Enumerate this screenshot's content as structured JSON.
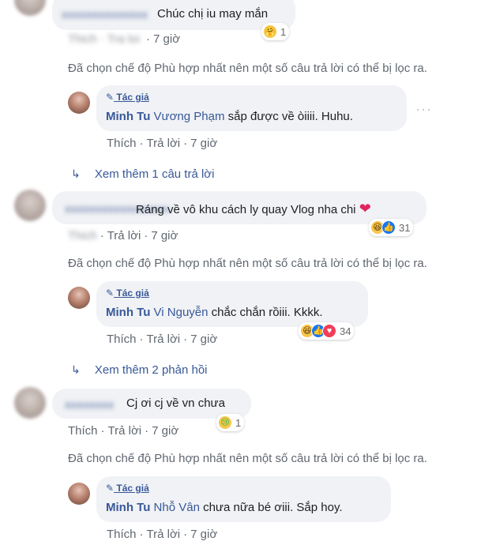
{
  "thread1": {
    "comment": {
      "text": "Chúc chị iu may mắn",
      "reaction_count": "1",
      "reaction_icon": "care-emoji",
      "meta": {
        "like": "Thích",
        "reply": "Trả lời",
        "time": "7 giờ"
      }
    },
    "filter_notice": "Đã chọn chế độ Phù hợp nhất nên một số câu trả lời có thể bị lọc ra.",
    "reply": {
      "badge": "Tác giả",
      "author": "Minh Tu",
      "tagged": "Vương Phạm",
      "text": "sắp được về òiiii. Huhu.",
      "meta": {
        "like": "Thích",
        "reply": "Trả lời",
        "time": "7 giờ"
      }
    },
    "more": "Xem thêm 1 câu trả lời"
  },
  "thread2": {
    "comment": {
      "text": "Ráng về vô khu cách ly quay Vlog nha chi",
      "reaction_count": "31",
      "meta": {
        "like": "Thích",
        "reply": "Trả lời",
        "time": "7 giờ"
      }
    },
    "filter_notice": "Đã chọn chế độ Phù hợp nhất nên một số câu trả lời có thể bị lọc ra.",
    "reply": {
      "badge": "Tác giả",
      "author": "Minh Tu",
      "tagged": "Vi Nguyễn",
      "text": "chắc chắn rồiii. Kkkk.",
      "reaction_count": "34",
      "meta": {
        "like": "Thích",
        "reply": "Trả lời",
        "time": "7 giờ"
      }
    },
    "more": "Xem thêm 2 phản hồi"
  },
  "thread3": {
    "comment": {
      "text": "Cj ơi cj về vn chưa",
      "reaction_count": "1",
      "meta": {
        "like": "Thích",
        "reply": "Trả lời",
        "time": "7 giờ"
      }
    },
    "filter_notice": "Đã chọn chế độ Phù hợp nhất nên một số câu trả lời có thể bị lọc ra.",
    "reply": {
      "badge": "Tác giả",
      "author": "Minh Tu",
      "tagged": "Nhỗ Vân",
      "text": "chưa nữa bé ơiii. Sắp hoy.",
      "meta": {
        "like": "Thích",
        "reply": "Trả lời",
        "time": "7 giờ"
      }
    }
  },
  "colors": {
    "link": "#385898",
    "meta": "#606770",
    "bubble": "#f0f2f5"
  }
}
